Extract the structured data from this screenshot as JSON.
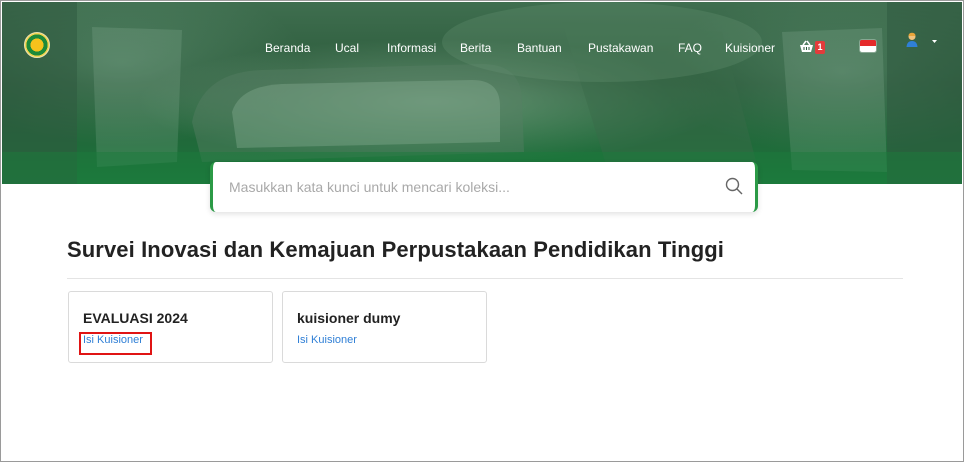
{
  "nav": {
    "items": [
      "Beranda",
      "Ucal",
      "Informasi",
      "Berita",
      "Bantuan",
      "Pustakawan",
      "FAQ",
      "Kuisioner"
    ],
    "cart_count": "1",
    "cart_icon": "basket-icon",
    "language_flag": "indonesia-flag-icon",
    "user_icon": "user-avatar-icon"
  },
  "search": {
    "placeholder": "Masukkan kata kunci untuk mencari koleksi..."
  },
  "page": {
    "title": "Survei Inovasi dan Kemajuan Perpustakaan Pendidikan Tinggi"
  },
  "cards": [
    {
      "title": "EVALUASI 2024",
      "link": "Isi Kuisioner"
    },
    {
      "title": "kuisioner dumy",
      "link": "Isi Kuisioner"
    }
  ],
  "colors": {
    "brand_green": "#2b9a46",
    "link_blue": "#2f7fd6",
    "badge_red": "#e23b3b",
    "highlight_red": "#e01414"
  }
}
